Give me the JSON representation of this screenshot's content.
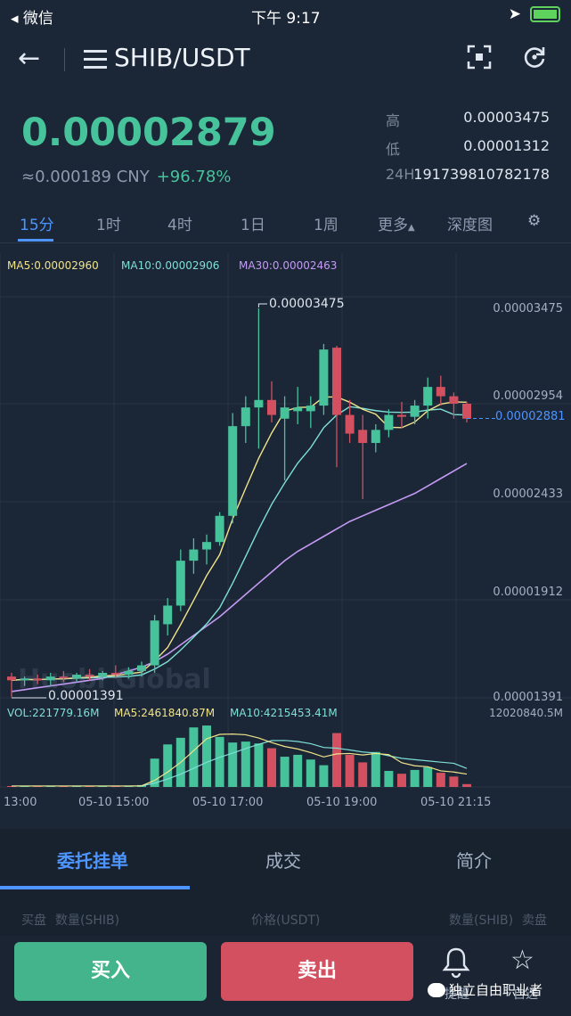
{
  "status_bar": {
    "carrier": "◂ 微信",
    "time": "下午 9:17"
  },
  "header": {
    "pair": "SHIB/USDT",
    "back_icon": "back-arrow-icon",
    "menu_icon": "list-icon",
    "scan_icon": "scan-icon",
    "refresh_icon": "refresh-icon"
  },
  "ticker": {
    "price": "0.00002879",
    "cny": "≈0.000189 CNY",
    "change": "+96.78%",
    "high_label": "高",
    "high": "0.00003475",
    "low_label": "低",
    "low": "0.00001312",
    "vol_label": "24H",
    "vol": "191739810782178"
  },
  "tabs": [
    "15分",
    "1时",
    "4时",
    "1日",
    "1周",
    "更多",
    "深度图"
  ],
  "chart": {
    "ma5": "MA5:0.00002960",
    "ma10": "MA10:0.00002906",
    "ma30": "MA30:0.00002463",
    "y_labels": [
      "0.00003475",
      "0.00002954",
      "0.00002433",
      "0.00001912",
      "0.00001391"
    ],
    "current_price": "0.00002881",
    "high_tag": "0.00003475",
    "low_tag": "0.00001391",
    "watermark": "Huobi Global",
    "vol_legend": "VOL:221779.16M",
    "vol_ma5": "MA5:2461840.87M",
    "vol_ma10": "MA10:4215453.41M",
    "vol_max": "12020840.5M",
    "x_labels": [
      "13:00",
      "05-10 15:00",
      "05-10 17:00",
      "05-10 19:00",
      "05-10 21:15"
    ]
  },
  "chart_data": {
    "type": "candlestick",
    "ylim": [
      1.391e-05,
      3.475e-05
    ],
    "candles": [
      {
        "o": 1.5e-05,
        "h": 1.52e-05,
        "l": 1.39e-05,
        "c": 1.48e-05,
        "up": false
      },
      {
        "o": 1.48e-05,
        "h": 1.5e-05,
        "l": 1.45e-05,
        "c": 1.49e-05,
        "up": true
      },
      {
        "o": 1.49e-05,
        "h": 1.51e-05,
        "l": 1.46e-05,
        "c": 1.48e-05,
        "up": false
      },
      {
        "o": 1.48e-05,
        "h": 1.52e-05,
        "l": 1.45e-05,
        "c": 1.5e-05,
        "up": true
      },
      {
        "o": 1.5e-05,
        "h": 1.53e-05,
        "l": 1.47e-05,
        "c": 1.49e-05,
        "up": false
      },
      {
        "o": 1.49e-05,
        "h": 1.52e-05,
        "l": 1.47e-05,
        "c": 1.51e-05,
        "up": true
      },
      {
        "o": 1.51e-05,
        "h": 1.54e-05,
        "l": 1.48e-05,
        "c": 1.5e-05,
        "up": false
      },
      {
        "o": 1.5e-05,
        "h": 1.53e-05,
        "l": 1.48e-05,
        "c": 1.52e-05,
        "up": true
      },
      {
        "o": 1.52e-05,
        "h": 1.56e-05,
        "l": 1.49e-05,
        "c": 1.51e-05,
        "up": false
      },
      {
        "o": 1.51e-05,
        "h": 1.55e-05,
        "l": 1.49e-05,
        "c": 1.53e-05,
        "up": true
      },
      {
        "o": 1.53e-05,
        "h": 1.58e-05,
        "l": 1.5e-05,
        "c": 1.56e-05,
        "up": true
      },
      {
        "o": 1.56e-05,
        "h": 1.83e-05,
        "l": 1.52e-05,
        "c": 1.8e-05,
        "up": true
      },
      {
        "o": 1.78e-05,
        "h": 1.92e-05,
        "l": 1.72e-05,
        "c": 1.88e-05,
        "up": true
      },
      {
        "o": 1.88e-05,
        "h": 2.18e-05,
        "l": 1.85e-05,
        "c": 2.12e-05,
        "up": true
      },
      {
        "o": 2.12e-05,
        "h": 2.24e-05,
        "l": 2.05e-05,
        "c": 2.18e-05,
        "up": true
      },
      {
        "o": 2.18e-05,
        "h": 2.26e-05,
        "l": 2.1e-05,
        "c": 2.22e-05,
        "up": true
      },
      {
        "o": 2.22e-05,
        "h": 2.38e-05,
        "l": 2.2e-05,
        "c": 2.36e-05,
        "up": true
      },
      {
        "o": 2.36e-05,
        "h": 2.91e-05,
        "l": 2.32e-05,
        "c": 2.84e-05,
        "up": true
      },
      {
        "o": 2.84e-05,
        "h": 3e-05,
        "l": 2.75e-05,
        "c": 2.94e-05,
        "up": true
      },
      {
        "o": 2.94e-05,
        "h": 3.47e-05,
        "l": 2.72e-05,
        "c": 2.98e-05,
        "up": true
      },
      {
        "o": 2.98e-05,
        "h": 3.08e-05,
        "l": 2.86e-05,
        "c": 2.9e-05,
        "up": false
      },
      {
        "o": 2.88e-05,
        "h": 3e-05,
        "l": 2.55e-05,
        "c": 2.94e-05,
        "up": true
      },
      {
        "o": 2.92e-05,
        "h": 3.05e-05,
        "l": 2.85e-05,
        "c": 2.94e-05,
        "up": true
      },
      {
        "o": 2.92e-05,
        "h": 3e-05,
        "l": 2.83e-05,
        "c": 2.95e-05,
        "up": true
      },
      {
        "o": 2.95e-05,
        "h": 3.28e-05,
        "l": 2.9e-05,
        "c": 3.25e-05,
        "up": true
      },
      {
        "o": 3.26e-05,
        "h": 3.27e-05,
        "l": 2.62e-05,
        "c": 2.9e-05,
        "up": false
      },
      {
        "o": 2.9e-05,
        "h": 2.98e-05,
        "l": 2.75e-05,
        "c": 2.8e-05,
        "up": false
      },
      {
        "o": 2.82e-05,
        "h": 2.9e-05,
        "l": 2.45e-05,
        "c": 2.75e-05,
        "up": false
      },
      {
        "o": 2.75e-05,
        "h": 2.85e-05,
        "l": 2.7e-05,
        "c": 2.82e-05,
        "up": true
      },
      {
        "o": 2.82e-05,
        "h": 2.93e-05,
        "l": 2.78e-05,
        "c": 2.9e-05,
        "up": true
      },
      {
        "o": 2.9e-05,
        "h": 2.97e-05,
        "l": 2.83e-05,
        "c": 2.89e-05,
        "up": false
      },
      {
        "o": 2.89e-05,
        "h": 2.98e-05,
        "l": 2.85e-05,
        "c": 2.95e-05,
        "up": true
      },
      {
        "o": 2.95e-05,
        "h": 3.1e-05,
        "l": 2.88e-05,
        "c": 3.05e-05,
        "up": true
      },
      {
        "o": 3.05e-05,
        "h": 3.11e-05,
        "l": 2.95e-05,
        "c": 3e-05,
        "up": false
      },
      {
        "o": 3e-05,
        "h": 3.02e-05,
        "l": 2.88e-05,
        "c": 2.96e-05,
        "up": false
      },
      {
        "o": 2.96e-05,
        "h": 2.97e-05,
        "l": 2.86e-05,
        "c": 2.88e-05,
        "up": false
      }
    ],
    "volume": [
      0.1,
      0.1,
      0.1,
      0.1,
      0.1,
      0.1,
      0.1,
      0.1,
      0.1,
      0.1,
      0.2,
      3.0,
      4.5,
      5.2,
      6.3,
      6.5,
      5.3,
      4.7,
      4.8,
      4.6,
      4.1,
      3.2,
      3.4,
      2.9,
      2.3,
      5.7,
      3.4,
      2.6,
      3.7,
      1.7,
      1.4,
      1.8,
      2.1,
      1.5,
      1.1,
      0.3
    ],
    "ma30": [
      1.42e-05,
      1.43e-05,
      1.44e-05,
      1.45e-05,
      1.46e-05,
      1.47e-05,
      1.48e-05,
      1.49e-05,
      1.51e-05,
      1.53e-05,
      1.55e-05,
      1.58e-05,
      1.62e-05,
      1.67e-05,
      1.72e-05,
      1.77e-05,
      1.82e-05,
      1.88e-05,
      1.94e-05,
      2e-05,
      2.06e-05,
      2.12e-05,
      2.17e-05,
      2.21e-05,
      2.25e-05,
      2.29e-05,
      2.33e-05,
      2.36e-05,
      2.39e-05,
      2.42e-05,
      2.45e-05,
      2.48e-05,
      2.52e-05,
      2.56e-05,
      2.6e-05,
      2.64e-05
    ]
  },
  "section": {
    "tabs": [
      "委托挂单",
      "成交",
      "简介"
    ],
    "headers": [
      "买盘",
      "数量(SHIB)",
      "价格(USDT)",
      "数量(SHIB)",
      "卖盘"
    ]
  },
  "bottom": {
    "buy": "买入",
    "sell": "卖出",
    "alert": "提醒",
    "favorite": "自选",
    "watermark": "独立自由职业者"
  },
  "colors": {
    "up": "#47c39b",
    "down": "#d2505f",
    "accent": "#4e95ff",
    "ma5": "#f1e48b",
    "ma10": "#7fe0d6",
    "ma30": "#c59bf5"
  }
}
